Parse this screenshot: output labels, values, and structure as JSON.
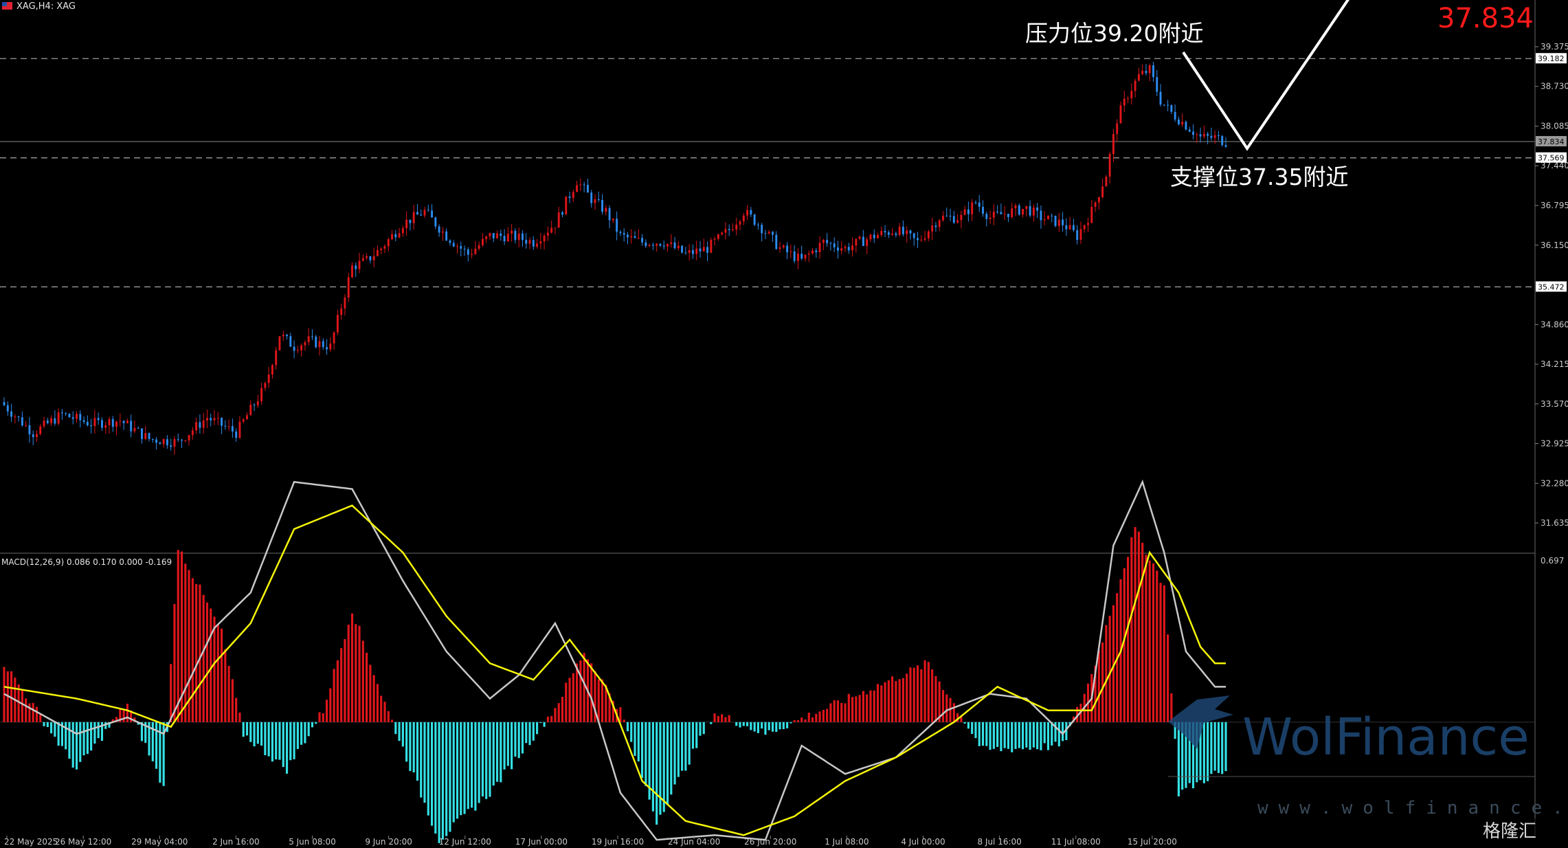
{
  "header": {
    "symbol_label": "XAG,H4:  XAG",
    "macd_label": "MACD(12,26,9) 0.086 0.170 0.000 -0.169",
    "current_price": "37.834"
  },
  "annotations": {
    "resistance": "压力位39.20附近",
    "support": "支撑位37.35附近"
  },
  "watermark": {
    "brand": "WolFinance",
    "url": "www.wolfinance.com",
    "corner": "格隆汇"
  },
  "colors": {
    "up": "#e0161b",
    "down": "#2d8cf0",
    "hist_pos": "#e0161b",
    "hist_neg": "#34e1e6",
    "macd_line": "#c8c8c8",
    "signal_line": "#f5f50a",
    "grid_dash": "#9a9a9a",
    "annotation": "#ffffff"
  },
  "chart_data": [
    {
      "type": "candlestick",
      "symbol": "XAG",
      "timeframe": "H4",
      "ylim": [
        31.2,
        40.0
      ],
      "yticks": [
        "39.375",
        "38.730",
        "38.085",
        "37.440",
        "36.795",
        "36.150",
        "34.860",
        "34.215",
        "33.570",
        "32.925",
        "32.280",
        "31.635"
      ],
      "price_tags": [
        "39.182",
        "37.834",
        "37.569",
        "35.472"
      ],
      "levels": [
        39.182,
        37.569,
        35.472
      ],
      "current_price": 37.834,
      "xticks": [
        "22 May 2025",
        "26 May 12:00",
        "29 May 04:00",
        "2 Jun 16:00",
        "5 Jun 08:00",
        "9 Jun 20:00",
        "12 Jun 12:00",
        "17 Jun 00:00",
        "19 Jun 16:00",
        "24 Jun 04:00",
        "26 Jun 20:00",
        "1 Jul 08:00",
        "4 Jul 00:00",
        "8 Jul 16:00",
        "11 Jul 08:00",
        "15 Jul 20:00"
      ],
      "close_path": [
        [
          0,
          33.55
        ],
        [
          8,
          33.1
        ],
        [
          16,
          33.4
        ],
        [
          24,
          33.25
        ],
        [
          32,
          33.3
        ],
        [
          40,
          33.0
        ],
        [
          48,
          32.95
        ],
        [
          56,
          33.35
        ],
        [
          64,
          33.1
        ],
        [
          72,
          33.85
        ],
        [
          76,
          34.7
        ],
        [
          80,
          34.5
        ],
        [
          84,
          34.6
        ],
        [
          90,
          34.5
        ],
        [
          96,
          35.8
        ],
        [
          100,
          35.9
        ],
        [
          104,
          36.1
        ],
        [
          110,
          36.5
        ],
        [
          116,
          36.7
        ],
        [
          122,
          36.3
        ],
        [
          128,
          36.0
        ],
        [
          134,
          36.3
        ],
        [
          140,
          36.3
        ],
        [
          146,
          36.2
        ],
        [
          152,
          36.5
        ],
        [
          158,
          37.2
        ],
        [
          162,
          36.9
        ],
        [
          166,
          36.7
        ],
        [
          170,
          36.3
        ],
        [
          176,
          36.2
        ],
        [
          182,
          36.2
        ],
        [
          188,
          36.0
        ],
        [
          194,
          36.1
        ],
        [
          200,
          36.4
        ],
        [
          204,
          36.7
        ],
        [
          208,
          36.5
        ],
        [
          214,
          36.1
        ],
        [
          220,
          35.9
        ],
        [
          226,
          36.2
        ],
        [
          232,
          36.1
        ],
        [
          240,
          36.3
        ],
        [
          246,
          36.4
        ],
        [
          252,
          36.2
        ],
        [
          258,
          36.6
        ],
        [
          264,
          36.6
        ],
        [
          268,
          36.85
        ],
        [
          272,
          36.6
        ],
        [
          278,
          36.7
        ],
        [
          282,
          36.75
        ],
        [
          286,
          36.6
        ],
        [
          292,
          36.5
        ],
        [
          296,
          36.3
        ],
        [
          300,
          36.7
        ],
        [
          304,
          37.3
        ],
        [
          307,
          38.2
        ],
        [
          310,
          38.6
        ],
        [
          313,
          38.9
        ],
        [
          316,
          39.0
        ],
        [
          319,
          38.5
        ],
        [
          322,
          38.3
        ],
        [
          326,
          38.1
        ],
        [
          330,
          37.9
        ],
        [
          334,
          37.9
        ],
        [
          337,
          37.83
        ]
      ],
      "macd_histogram_peaks": [
        [
          0,
          0.25
        ],
        [
          20,
          -0.2
        ],
        [
          34,
          0.08
        ],
        [
          44,
          -0.28
        ],
        [
          48,
          0.75
        ],
        [
          60,
          0.38
        ],
        [
          66,
          -0.05
        ],
        [
          78,
          -0.2
        ],
        [
          88,
          0.05
        ],
        [
          96,
          0.48
        ],
        [
          104,
          0.12
        ],
        [
          120,
          -0.5
        ],
        [
          134,
          -0.3
        ],
        [
          152,
          0.06
        ],
        [
          160,
          0.3
        ],
        [
          170,
          0.05
        ],
        [
          180,
          -0.42
        ],
        [
          196,
          0.04
        ],
        [
          210,
          -0.05
        ],
        [
          230,
          0.08
        ],
        [
          255,
          0.25
        ],
        [
          270,
          -0.12
        ],
        [
          292,
          -0.1
        ],
        [
          300,
          0.2
        ],
        [
          312,
          0.82
        ],
        [
          320,
          0.58
        ],
        [
          324,
          -0.3
        ],
        [
          334,
          -0.22
        ]
      ],
      "macd_main_path": [
        [
          0,
          0.12
        ],
        [
          20,
          -0.05
        ],
        [
          34,
          0.02
        ],
        [
          44,
          -0.05
        ],
        [
          58,
          0.4
        ],
        [
          68,
          0.55
        ],
        [
          80,
          1.02
        ],
        [
          96,
          0.99
        ],
        [
          110,
          0.6
        ],
        [
          122,
          0.3
        ],
        [
          134,
          0.1
        ],
        [
          142,
          0.2
        ],
        [
          152,
          0.42
        ],
        [
          162,
          0.1
        ],
        [
          170,
          -0.3
        ],
        [
          180,
          -0.5
        ],
        [
          196,
          -0.48
        ],
        [
          210,
          -0.5
        ],
        [
          220,
          -0.1
        ],
        [
          232,
          -0.22
        ],
        [
          246,
          -0.15
        ],
        [
          260,
          0.05
        ],
        [
          272,
          0.12
        ],
        [
          282,
          0.1
        ],
        [
          292,
          -0.05
        ],
        [
          300,
          0.1
        ],
        [
          306,
          0.75
        ],
        [
          314,
          1.02
        ],
        [
          320,
          0.72
        ],
        [
          326,
          0.3
        ],
        [
          334,
          0.15
        ]
      ],
      "macd_signal_path": [
        [
          0,
          0.15
        ],
        [
          20,
          0.1
        ],
        [
          34,
          0.05
        ],
        [
          46,
          -0.02
        ],
        [
          58,
          0.25
        ],
        [
          68,
          0.42
        ],
        [
          80,
          0.82
        ],
        [
          96,
          0.92
        ],
        [
          110,
          0.72
        ],
        [
          122,
          0.45
        ],
        [
          134,
          0.25
        ],
        [
          146,
          0.18
        ],
        [
          156,
          0.35
        ],
        [
          166,
          0.15
        ],
        [
          176,
          -0.25
        ],
        [
          188,
          -0.42
        ],
        [
          204,
          -0.48
        ],
        [
          218,
          -0.4
        ],
        [
          232,
          -0.25
        ],
        [
          246,
          -0.15
        ],
        [
          262,
          0.0
        ],
        [
          274,
          0.15
        ],
        [
          288,
          0.05
        ],
        [
          300,
          0.05
        ],
        [
          308,
          0.3
        ],
        [
          316,
          0.72
        ],
        [
          324,
          0.55
        ],
        [
          330,
          0.32
        ],
        [
          334,
          0.25
        ]
      ],
      "macd_scale": [
        -0.45,
        0.697
      ],
      "macd_yticks": [
        "0.697"
      ]
    }
  ]
}
